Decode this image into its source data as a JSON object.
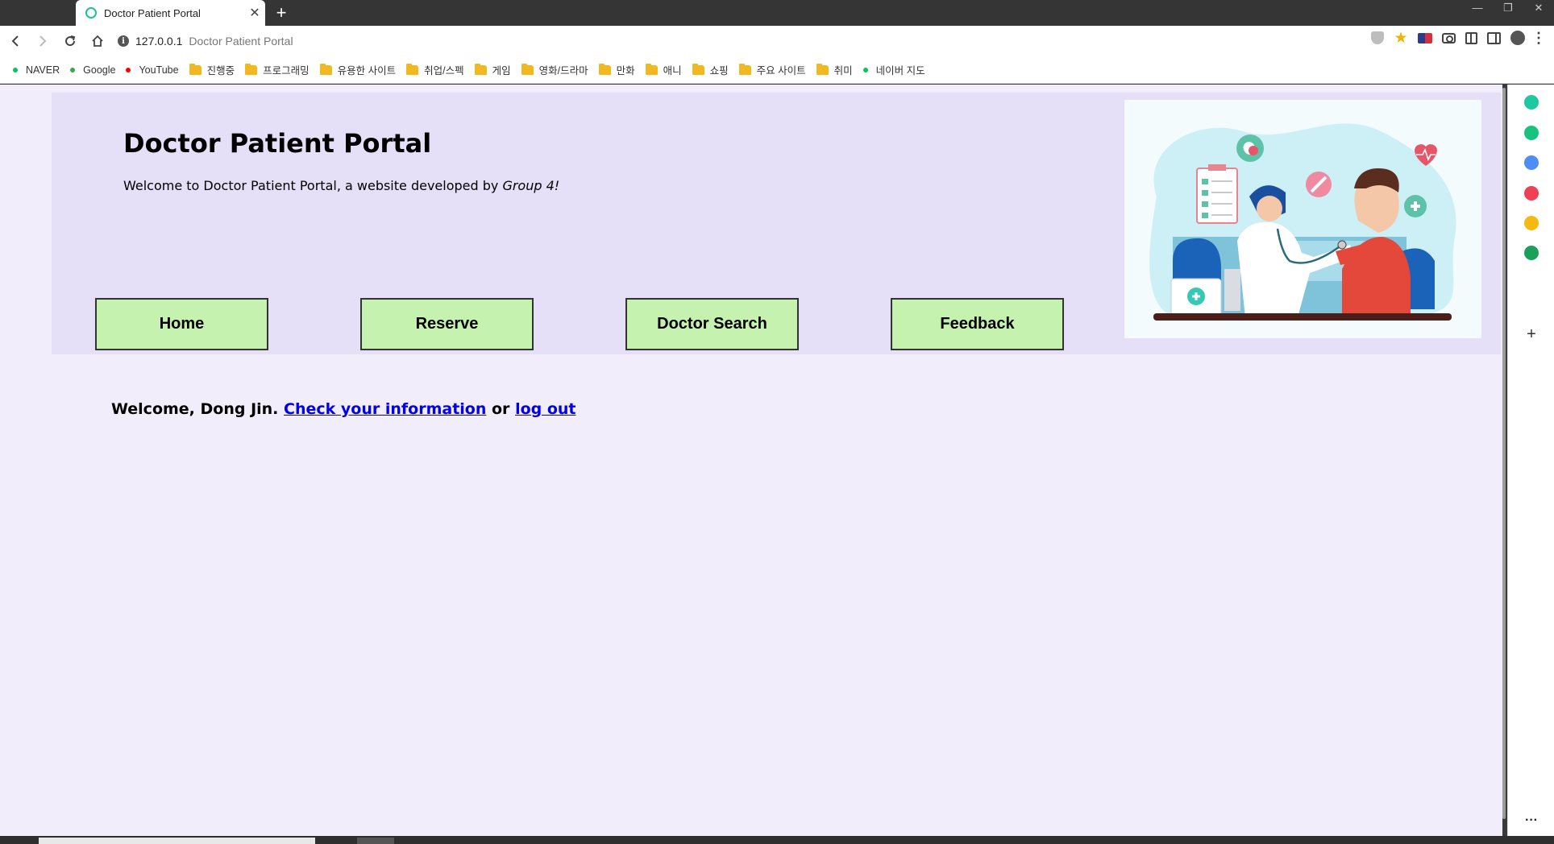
{
  "browser": {
    "tab": {
      "title": "Doctor Patient Portal",
      "close_glyph": "✕"
    },
    "new_tab_glyph": "+",
    "window_controls": {
      "minimize": "—",
      "restore": "❐",
      "close": "✕"
    },
    "address": {
      "host": "127.0.0.1",
      "page_title": "Doctor Patient Portal"
    },
    "bookmarks": [
      {
        "label": "NAVER",
        "type": "site",
        "color": "#03c75a"
      },
      {
        "label": "Google",
        "type": "site",
        "color": "#34a853"
      },
      {
        "label": "YouTube",
        "type": "site",
        "color": "#ff0000"
      },
      {
        "label": "진행중",
        "type": "folder"
      },
      {
        "label": "프로그래밍",
        "type": "folder"
      },
      {
        "label": "유용한 사이트",
        "type": "folder"
      },
      {
        "label": "취업/스펙",
        "type": "folder"
      },
      {
        "label": "게임",
        "type": "folder"
      },
      {
        "label": "영화/드라마",
        "type": "folder"
      },
      {
        "label": "만화",
        "type": "folder"
      },
      {
        "label": "애니",
        "type": "folder"
      },
      {
        "label": "쇼핑",
        "type": "folder"
      },
      {
        "label": "주요 사이트",
        "type": "folder"
      },
      {
        "label": "취미",
        "type": "folder"
      },
      {
        "label": "네이버 지도",
        "type": "site",
        "color": "#03c75a"
      }
    ],
    "sidebar_icons": [
      {
        "name": "naver-app-icon",
        "color": "#1ec8a0"
      },
      {
        "name": "chat-app-icon",
        "color": "#19c37d"
      },
      {
        "name": "wallet-app-icon",
        "color": "#4c8df6"
      },
      {
        "name": "pocket-app-icon",
        "color": "#ef4056"
      },
      {
        "name": "favorites-app-icon",
        "color": "#f6b913"
      },
      {
        "name": "edge-app-icon",
        "color": "#1aa05a"
      }
    ]
  },
  "page": {
    "title": "Doctor Patient Portal",
    "subtitle_prefix": "Welcome to Doctor Patient Portal, a website developed by ",
    "subtitle_group": "Group 4!",
    "nav": [
      "Home",
      "Reserve",
      "Doctor Search",
      "Feedback"
    ],
    "welcome": {
      "greeting": "Welcome, Dong Jin.",
      "check_link": "Check your information",
      "or": "or",
      "logout_link": "log out"
    }
  },
  "colors": {
    "background": "#f1edfa",
    "header_panel": "#e5dff7",
    "nav_button": "#c5f2ae",
    "link": "#0000ee"
  }
}
